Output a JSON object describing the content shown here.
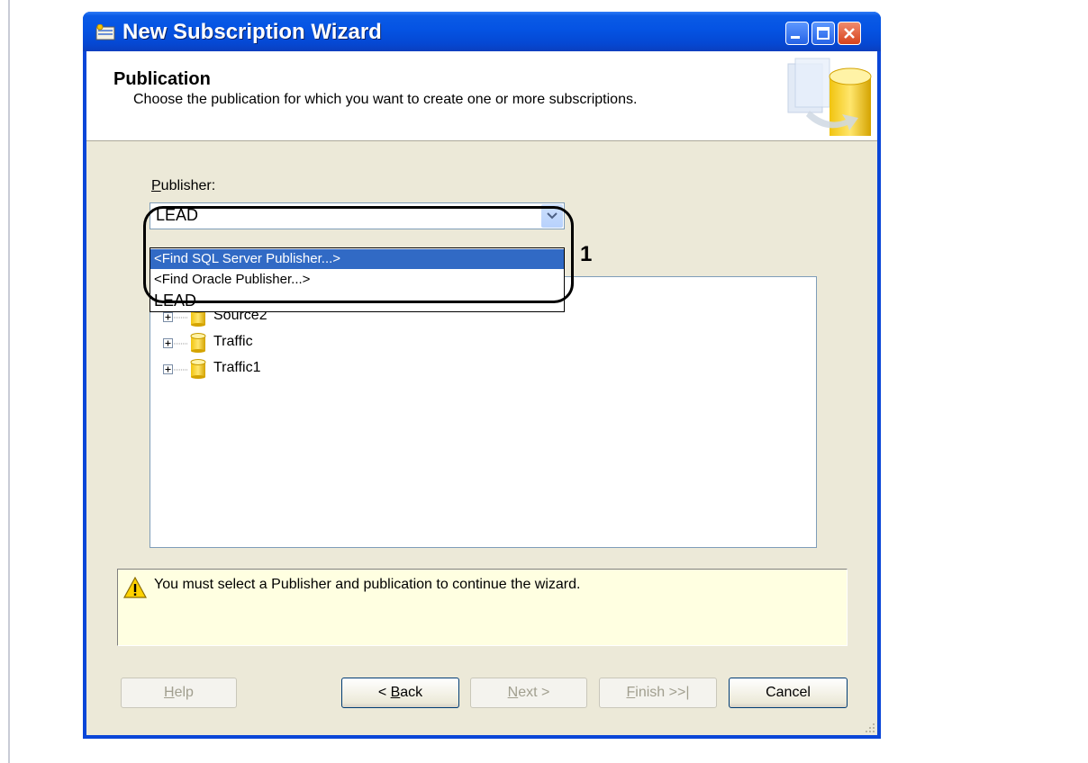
{
  "window": {
    "title": "New Subscription Wizard",
    "buttons": [
      "minimize-icon",
      "maximize-icon",
      "close-icon"
    ]
  },
  "header": {
    "title": "Publication",
    "subtitle": "Choose the publication for which you want to create one or more subscriptions."
  },
  "publisher": {
    "label_accel": "P",
    "label_rest": "ublisher:",
    "selected": "LEAD",
    "dropdown_options": [
      "<Find SQL Server Publisher...>",
      "<Find Oracle Publisher...>",
      "LEAD"
    ],
    "highlighted_index": 0
  },
  "annotation": {
    "number": "1"
  },
  "tree": {
    "items": [
      {
        "label": "Source2",
        "icon": "database-icon",
        "expander": "plus"
      },
      {
        "label": "Traffic",
        "icon": "database-icon",
        "expander": "plus"
      },
      {
        "label": "Traffic1",
        "icon": "database-icon",
        "expander": "plus"
      }
    ]
  },
  "message": {
    "icon": "warning-icon",
    "text": "You must select a Publisher and publication to continue the wizard."
  },
  "buttons": {
    "help": {
      "accel": "H",
      "rest": "elp",
      "enabled": false
    },
    "back": {
      "prefix": "< ",
      "accel": "B",
      "rest": "ack",
      "enabled": true
    },
    "next": {
      "accel": "N",
      "rest": "ext >",
      "enabled": false
    },
    "finish": {
      "accel": "F",
      "rest": "inish >>|",
      "enabled": false
    },
    "cancel": {
      "label": "Cancel",
      "enabled": true
    }
  },
  "colors": {
    "titlebar": "#0553e3",
    "client": "#ece9d8",
    "selection": "#316ac5",
    "message_bg": "#ffffe1"
  }
}
